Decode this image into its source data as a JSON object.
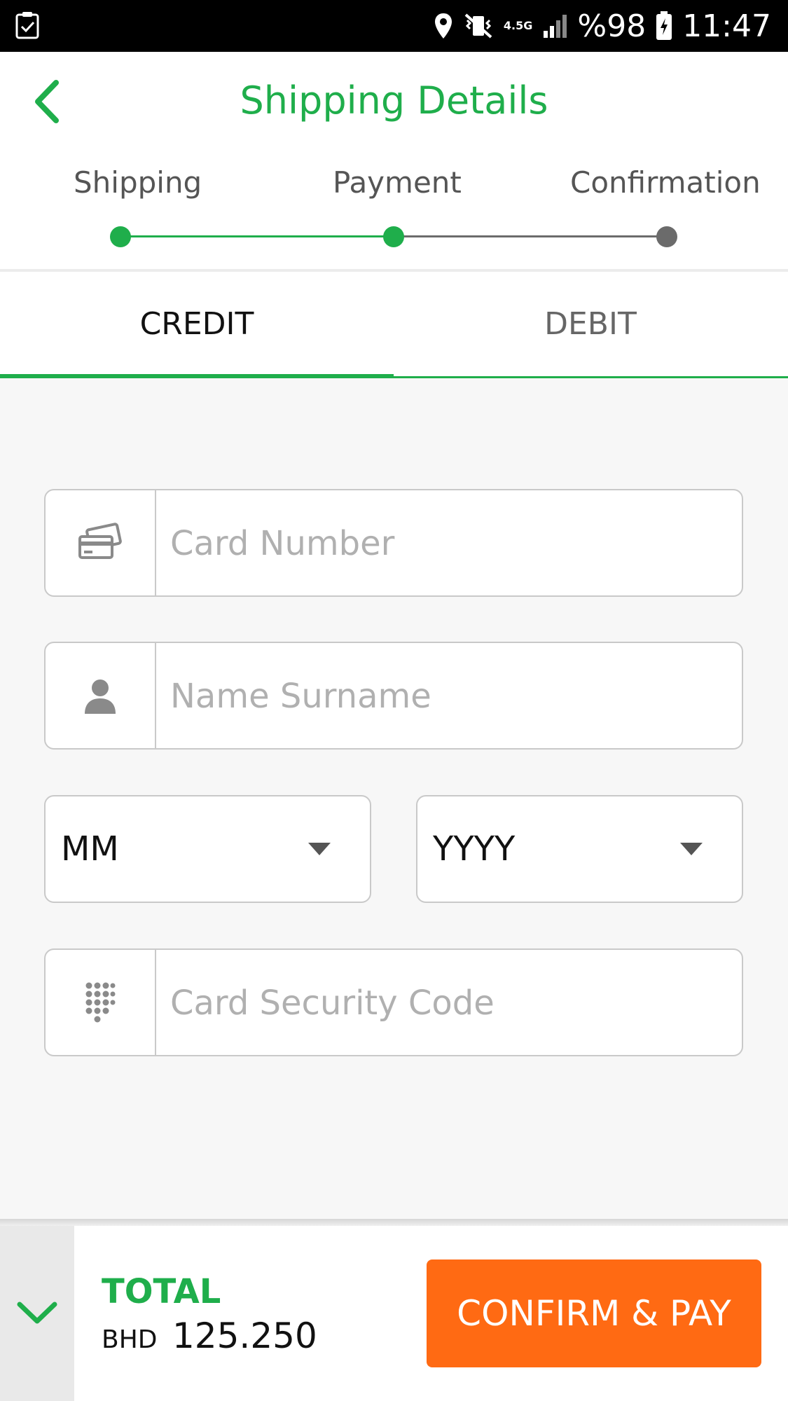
{
  "status_bar": {
    "network": "4.5G",
    "battery": "%98",
    "time": "11:47"
  },
  "header": {
    "title": "Shipping Details",
    "steps": [
      {
        "label": "Shipping",
        "state": "done"
      },
      {
        "label": "Payment",
        "state": "active"
      },
      {
        "label": "Confirmation",
        "state": "pending"
      }
    ]
  },
  "tabs": [
    {
      "label": "CREDIT",
      "selected": true
    },
    {
      "label": "DEBIT",
      "selected": false
    }
  ],
  "form": {
    "card_number": {
      "placeholder": "Card Number",
      "icon": "credit-card-icon"
    },
    "name": {
      "placeholder": "Name Surname",
      "icon": "person-icon"
    },
    "month": {
      "value": "MM"
    },
    "year": {
      "value": "YYYY"
    },
    "security_code": {
      "placeholder": "Card Security Code",
      "icon": "keypad-icon"
    }
  },
  "footer": {
    "total_label": "TOTAL",
    "currency": "BHD",
    "amount": "125.250",
    "pay_label": "CONFIRM & PAY"
  },
  "colors": {
    "accent": "#1fae4b",
    "pay_button": "#ff6a13",
    "pending": "#6b6b6b"
  }
}
